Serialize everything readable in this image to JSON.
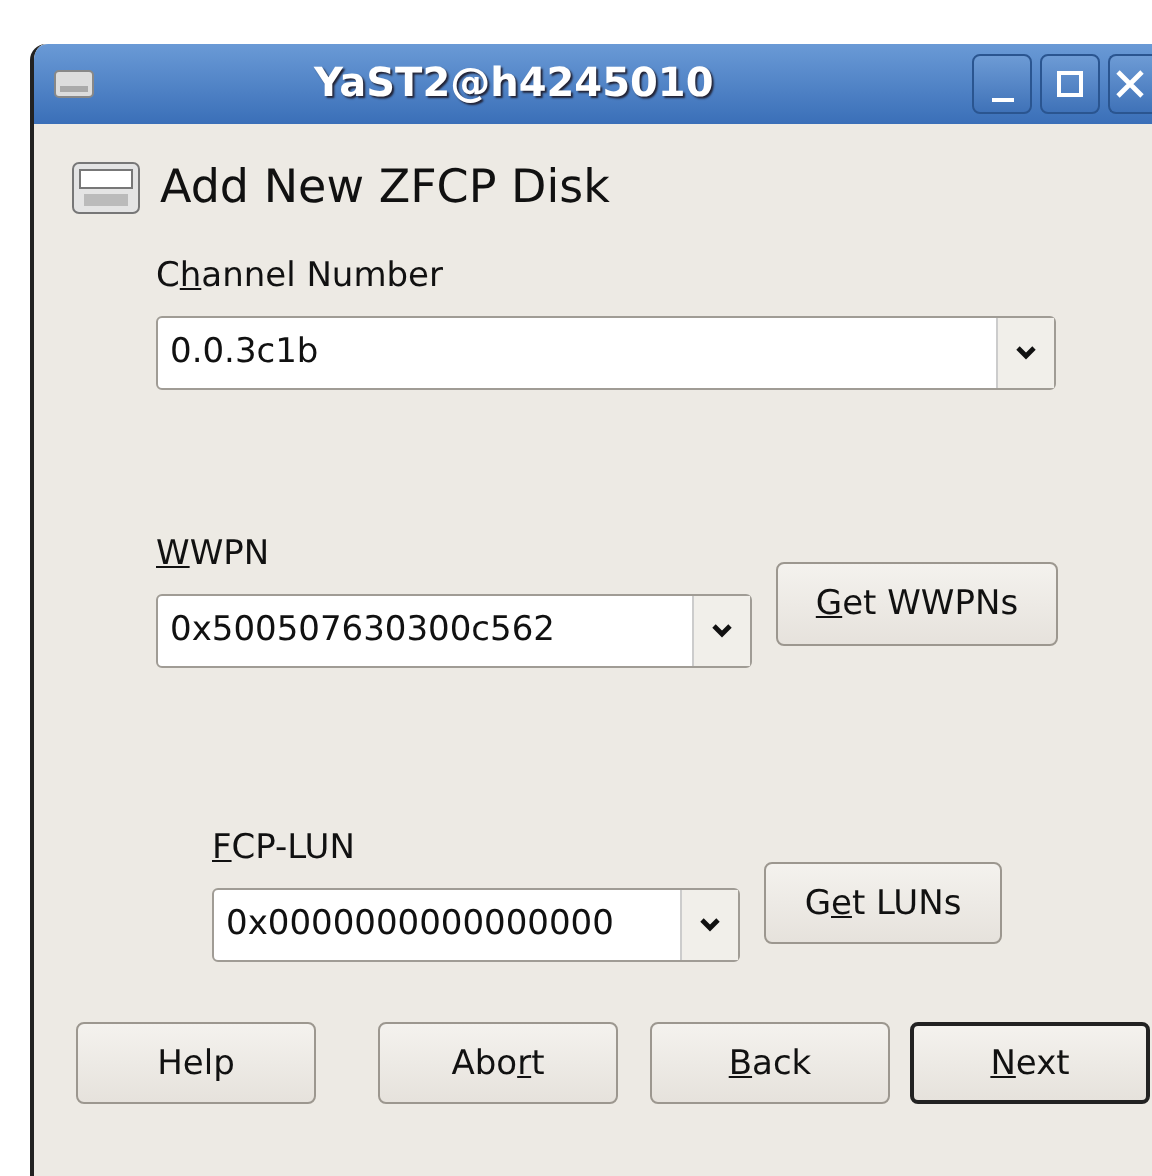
{
  "window": {
    "title": "YaST2@h4245010"
  },
  "heading": "Add New ZFCP Disk",
  "channel": {
    "label": {
      "pre": "C",
      "key": "h",
      "post": "annel Number"
    },
    "value": "0.0.3c1b"
  },
  "wwpn": {
    "label": {
      "key": "W",
      "post": "WPN"
    },
    "value": "0x500507630300c562",
    "button": {
      "key": "G",
      "post": "et WWPNs"
    }
  },
  "lun": {
    "label": {
      "key": "F",
      "post": "CP-LUN"
    },
    "value": "0x0000000000000000",
    "button": {
      "pre": "G",
      "key": "e",
      "post": "t LUNs"
    }
  },
  "buttons": [
    {
      "label": {
        "pre": "Help"
      },
      "default": false
    },
    {
      "label": {
        "pre": "Abo",
        "key": "r",
        "post": "t"
      },
      "default": false
    },
    {
      "label": {
        "key": "B",
        "post": "ack"
      },
      "default": false
    },
    {
      "label": {
        "key": "N",
        "post": "ext"
      },
      "default": true
    }
  ]
}
